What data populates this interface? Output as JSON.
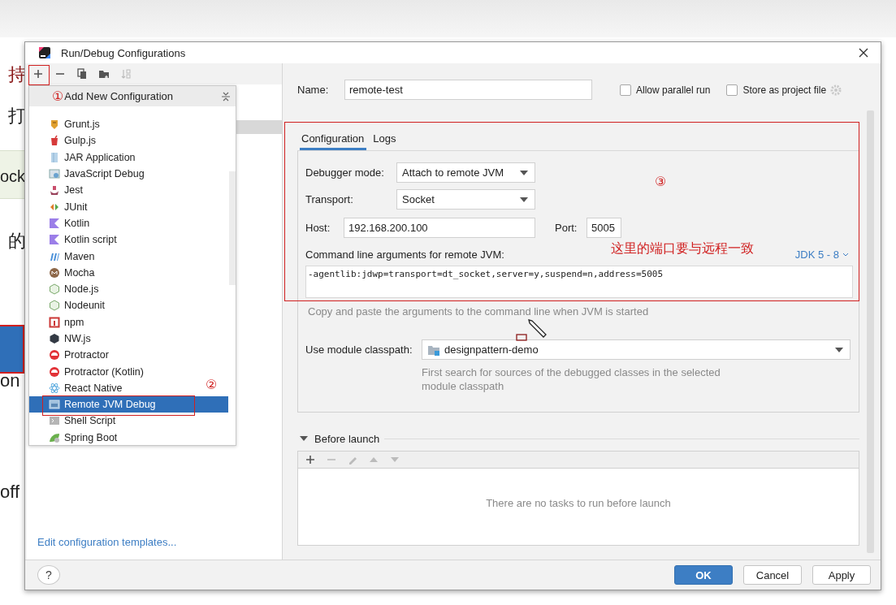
{
  "background": {
    "fragments": [
      {
        "text": "持",
        "color": "#8b1a1a"
      },
      {
        "text": "打",
        "color": "#222222"
      },
      {
        "text": "ock",
        "color": "#222222"
      },
      {
        "text": "的",
        "color": "#222222"
      },
      {
        "text": "on",
        "color": "#222222"
      },
      {
        "text": "off",
        "color": "#222222"
      }
    ]
  },
  "dialog": {
    "title": "Run/Debug Configurations",
    "toolbar": [
      {
        "kind": "add",
        "disabled": false
      },
      {
        "kind": "remove",
        "disabled": false
      },
      {
        "kind": "copy",
        "disabled": false
      },
      {
        "kind": "folder",
        "disabled": false
      },
      {
        "kind": "sort",
        "disabled": true
      }
    ],
    "popup": {
      "marker": "①",
      "title": "Add New Configuration",
      "items": [
        {
          "label": "Grunt.js",
          "kind": "grunt",
          "selected": false
        },
        {
          "label": "Gulp.js",
          "kind": "gulp",
          "selected": false
        },
        {
          "label": "JAR Application",
          "kind": "jar",
          "selected": false
        },
        {
          "label": "JavaScript Debug",
          "kind": "jsdebug",
          "selected": false
        },
        {
          "label": "Jest",
          "kind": "jest",
          "selected": false
        },
        {
          "label": "JUnit",
          "kind": "junit",
          "selected": false
        },
        {
          "label": "Kotlin",
          "kind": "kotlin",
          "selected": false
        },
        {
          "label": "Kotlin script",
          "kind": "kotlin",
          "selected": false
        },
        {
          "label": "Maven",
          "kind": "maven",
          "selected": false
        },
        {
          "label": "Mocha",
          "kind": "mocha",
          "selected": false
        },
        {
          "label": "Node.js",
          "kind": "node",
          "selected": false
        },
        {
          "label": "Nodeunit",
          "kind": "node",
          "selected": false
        },
        {
          "label": "npm",
          "kind": "npm",
          "selected": false
        },
        {
          "label": "NW.js",
          "kind": "nw",
          "selected": false
        },
        {
          "label": "Protractor",
          "kind": "protractor",
          "selected": false
        },
        {
          "label": "Protractor (Kotlin)",
          "kind": "protractor",
          "selected": false
        },
        {
          "label": "React Native",
          "kind": "react",
          "selected": false
        },
        {
          "label": "Remote JVM Debug",
          "kind": "remote",
          "selected": true
        },
        {
          "label": "Shell Script",
          "kind": "shell",
          "selected": false
        },
        {
          "label": "Spring Boot",
          "kind": "spring",
          "selected": false
        }
      ]
    },
    "templates_link": "Edit configuration templates...",
    "help_button": "?",
    "name": {
      "label": "Name:",
      "value": "remote-test"
    },
    "options": [
      {
        "label": "Allow parallel run",
        "checked": false
      },
      {
        "label": "Store as project file",
        "checked": false
      }
    ],
    "tabs": [
      {
        "label": "Configuration",
        "selected": true
      },
      {
        "label": "Logs",
        "selected": false
      }
    ],
    "debugger_mode": {
      "label": "Debugger mode:",
      "value": "Attach to remote JVM"
    },
    "transport": {
      "label": "Transport:",
      "value": "Socket"
    },
    "host": {
      "label": "Host:",
      "value": "192.168.200.100"
    },
    "port": {
      "label": "Port:",
      "value": "5005"
    },
    "command_line": {
      "label": "Command line arguments for remote JVM:",
      "jdk": "JDK 5 - 8",
      "value": "-agentlib:jdwp=transport=dt_socket,server=y,suspend=n,address=5005",
      "hint": "Copy and paste the arguments to the command line when JVM is started"
    },
    "module_classpath": {
      "label": "Use module classpath:",
      "value": "designpattern-demo",
      "hint": "First search for sources of the debugged classes in the selected module classpath"
    },
    "before_launch": {
      "title": "Before launch",
      "expanded": true,
      "tools": [
        {
          "kind": "add",
          "disabled": false
        },
        {
          "kind": "remove",
          "disabled": true
        },
        {
          "kind": "edit",
          "disabled": true
        },
        {
          "kind": "up",
          "disabled": true
        },
        {
          "kind": "down",
          "disabled": true
        }
      ],
      "empty_text": "There are no tasks to run before launch"
    },
    "buttons": [
      {
        "label": "OK",
        "kind": "primary"
      },
      {
        "label": "Cancel",
        "kind": "normal"
      },
      {
        "label": "Apply",
        "kind": "normal"
      }
    ]
  },
  "annotations": [
    {
      "kind": "number",
      "text": "②"
    },
    {
      "kind": "number",
      "text": "③"
    },
    {
      "kind": "note",
      "text": "这里的端口要与远程一致"
    }
  ]
}
